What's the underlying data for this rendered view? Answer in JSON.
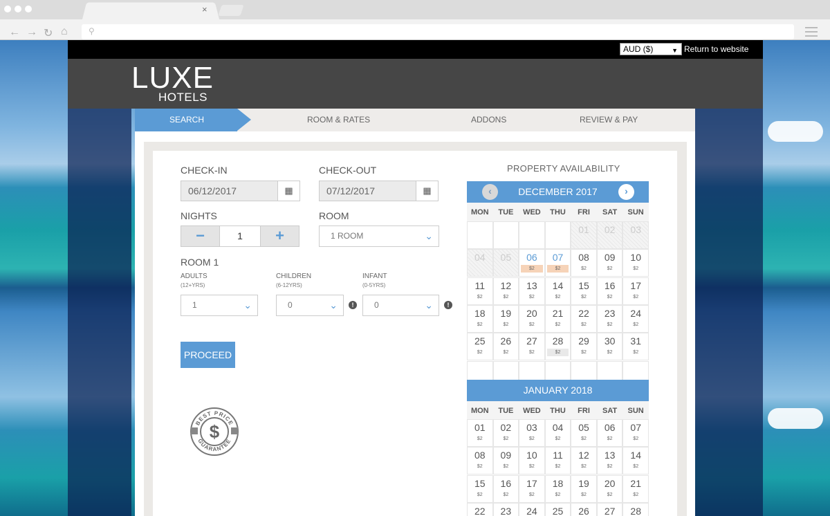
{
  "browser": {
    "tab_close": "×",
    "nav_back": "←",
    "nav_forward": "→",
    "nav_reload": "↻",
    "nav_home": "⌂",
    "search_icon": "⚲"
  },
  "topbar": {
    "currency": "AUD ($)",
    "return_link": "Return to website"
  },
  "logo": {
    "line1": "LUXE",
    "line2": "HOTELS"
  },
  "steps": [
    "SEARCH",
    "ROOM & RATES",
    "ADDONS",
    "REVIEW & PAY"
  ],
  "form": {
    "checkin_label": "CHECK-IN",
    "checkin_value": "06/12/2017",
    "checkout_label": "CHECK-OUT",
    "checkout_value": "07/12/2017",
    "nights_label": "NIGHTS",
    "nights_value": "1",
    "minus": "−",
    "plus": "+",
    "room_label": "ROOM",
    "room_value": "1 ROOM",
    "room1_label": "ROOM 1",
    "adults_label": "ADULTS",
    "adults_sub": "(12+YRS)",
    "adults_value": "1",
    "children_label": "CHILDREN",
    "children_sub": "(6-12YRS)",
    "children_value": "0",
    "infant_label": "INFANT",
    "infant_sub": "(0-5YRS)",
    "infant_value": "0",
    "info_icon": "!",
    "proceed": "PROCEED",
    "badge_top": "BEST PRICE",
    "badge_bottom": "GUARANTEE",
    "badge_symbol": "$"
  },
  "calendar": {
    "title": "PROPERTY AVAILABILITY",
    "weekdays": [
      "MON",
      "TUE",
      "WED",
      "THU",
      "FRI",
      "SAT",
      "SUN"
    ],
    "price": "$2",
    "dec": {
      "label": "DECEMBER 2017",
      "prev": "‹",
      "next": "›",
      "days": [
        "01",
        "02",
        "03",
        "04",
        "05",
        "06",
        "07",
        "08",
        "09",
        "10",
        "11",
        "12",
        "13",
        "14",
        "15",
        "16",
        "17",
        "18",
        "19",
        "20",
        "21",
        "22",
        "23",
        "24",
        "25",
        "26",
        "27",
        "28",
        "29",
        "30",
        "31"
      ]
    },
    "jan": {
      "label": "JANUARY 2018",
      "days": [
        "01",
        "02",
        "03",
        "04",
        "05",
        "06",
        "07",
        "08",
        "09",
        "10",
        "11",
        "12",
        "13",
        "14",
        "15",
        "16",
        "17",
        "18",
        "19",
        "20",
        "21",
        "22",
        "23",
        "24",
        "25",
        "26",
        "27",
        "28"
      ]
    }
  },
  "colors": {
    "accent": "#5b9bd5",
    "header": "#464646",
    "selected_price": "#f6d3b8"
  }
}
